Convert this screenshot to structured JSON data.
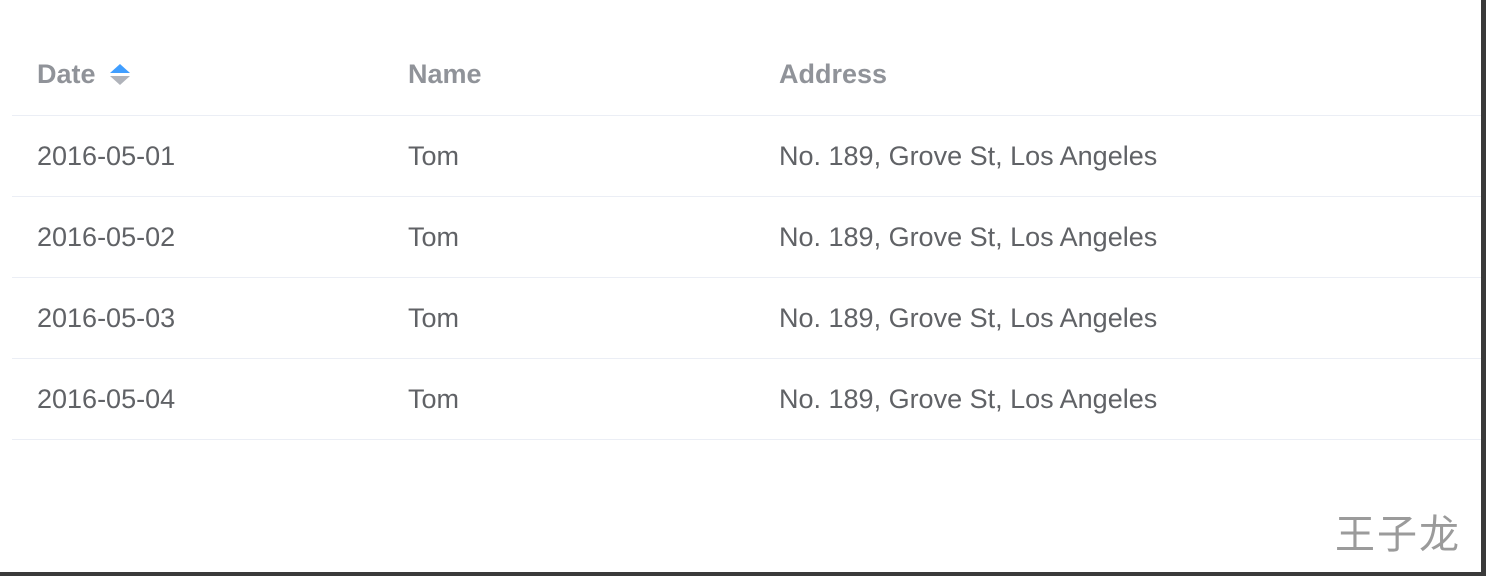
{
  "table": {
    "headers": {
      "date": "Date",
      "name": "Name",
      "address": "Address"
    },
    "sort": {
      "column": "date",
      "direction": "ascending",
      "active_color": "#409eff"
    },
    "rows": [
      {
        "date": "2016-05-01",
        "name": "Tom",
        "address": "No. 189, Grove St, Los Angeles"
      },
      {
        "date": "2016-05-02",
        "name": "Tom",
        "address": "No. 189, Grove St, Los Angeles"
      },
      {
        "date": "2016-05-03",
        "name": "Tom",
        "address": "No. 189, Grove St, Los Angeles"
      },
      {
        "date": "2016-05-04",
        "name": "Tom",
        "address": "No. 189, Grove St, Los Angeles"
      }
    ]
  },
  "watermark": "王子龙"
}
